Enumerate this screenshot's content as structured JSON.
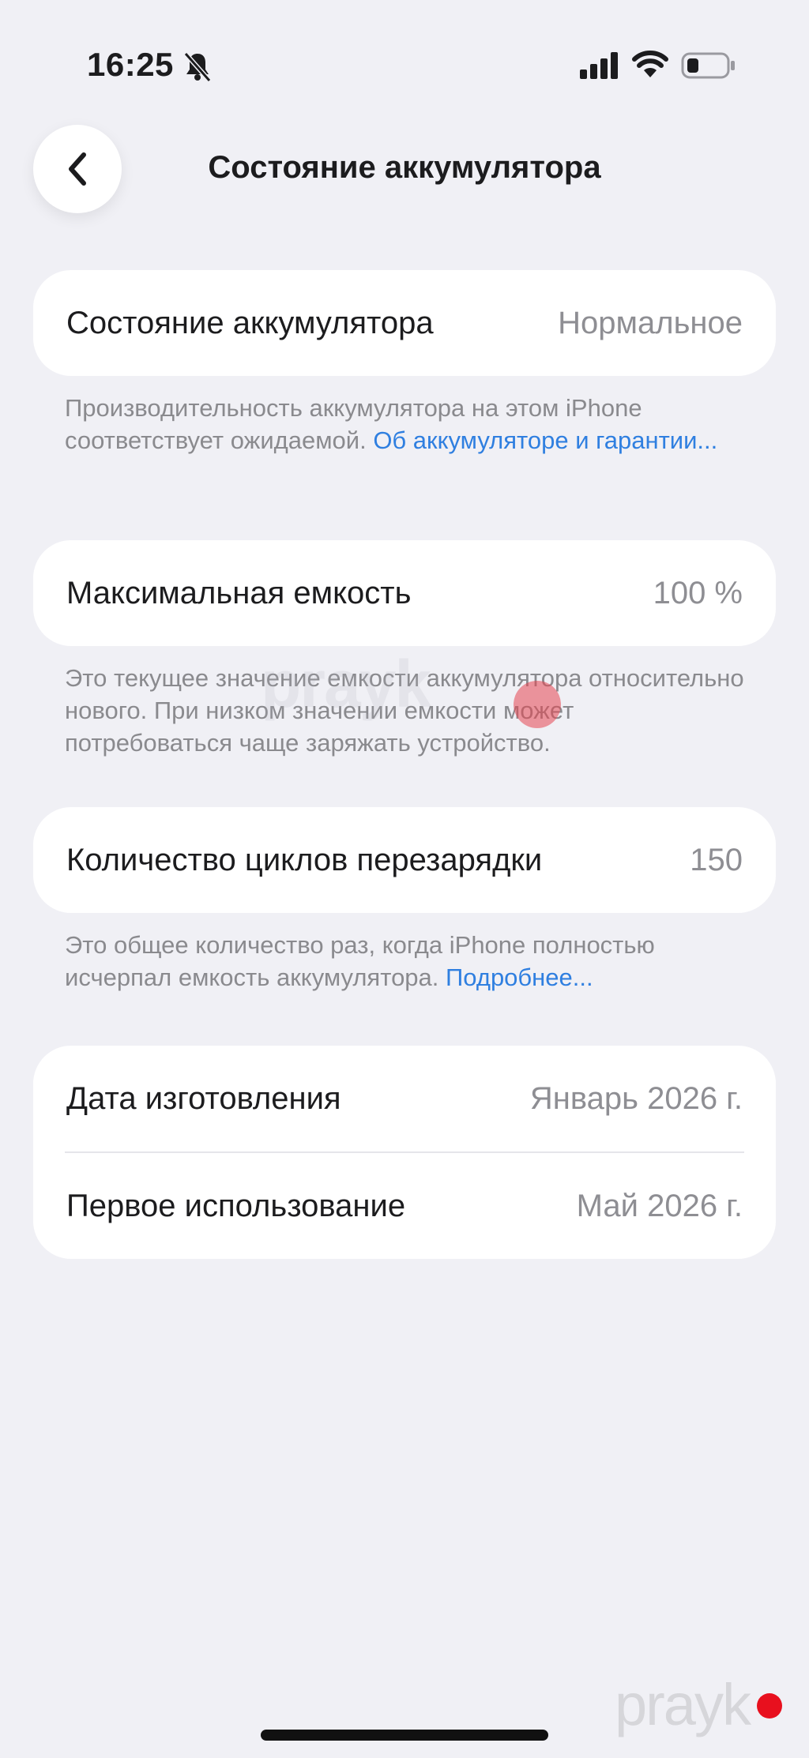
{
  "status_bar": {
    "time": "16:25",
    "icons": [
      "bell-slash-icon",
      "cellular-signal-icon",
      "wifi-icon",
      "battery-low-icon"
    ]
  },
  "nav": {
    "back_icon": "chevron-left-icon",
    "title": "Состояние аккумулятора"
  },
  "battery_health": {
    "label": "Состояние аккумулятора",
    "value": "Нормальное",
    "footnote_text": "Производительность аккумулятора на этом iPhone соответствует ожидаемой. ",
    "footnote_link": "Об аккумуляторе и гарантии..."
  },
  "max_capacity": {
    "label": "Максимальная емкость",
    "value": "100 %",
    "footnote_text": "Это текущее значение емкости аккумулятора относительно нового. При низком значении емкости может потребоваться чаще заряжать устройство."
  },
  "cycle_count": {
    "label": "Количество циклов перезарядки",
    "value": "150",
    "footnote_text": "Это общее количество раз, когда iPhone полностью исчерпал емкость аккумулятора. ",
    "footnote_link": "Подробнее..."
  },
  "dates": {
    "manufacture_label": "Дата изготовления",
    "manufacture_value": "Январь 2026 г.",
    "first_use_label": "Первое использование",
    "first_use_value": "Май 2026 г."
  },
  "watermark": {
    "text": "prayk"
  },
  "colors": {
    "background": "#f0f0f5",
    "card": "#ffffff",
    "link": "#2f7fe0",
    "secondary_text": "#8e8e93",
    "brand_dot": "#e8101e"
  }
}
